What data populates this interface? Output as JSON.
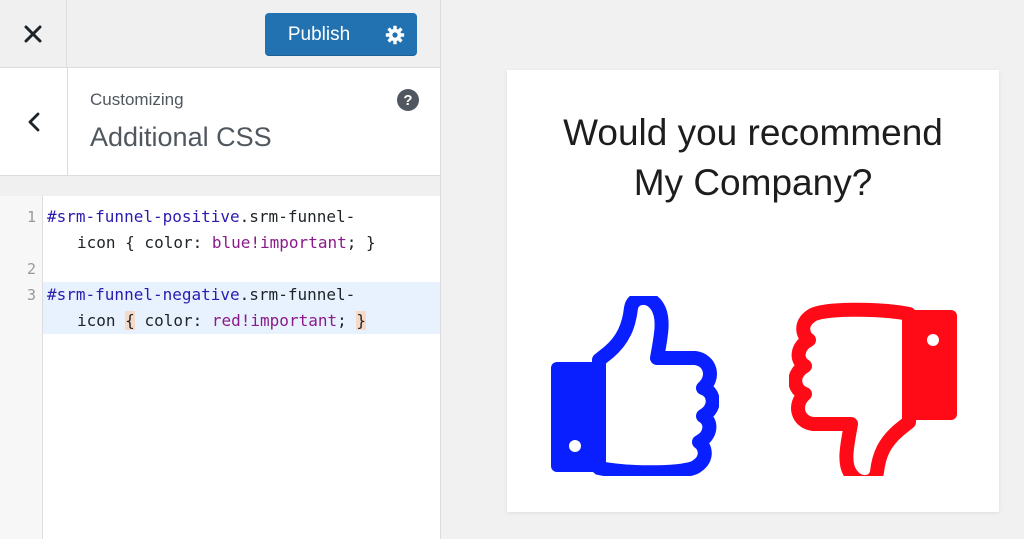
{
  "toolbar": {
    "publish_label": "Publish",
    "close_icon": "close-icon",
    "settings_icon": "gear-icon"
  },
  "section": {
    "breadcrumb": "Customizing",
    "title": "Additional CSS",
    "help_icon": "help-icon",
    "help_glyph": "?",
    "back_icon": "chevron-left-icon"
  },
  "editor": {
    "lines": [
      {
        "number": "1",
        "parts": [
          "#srm-funnel-positive",
          ".srm-funnel-"
        ],
        "cont": [
          "icon",
          " { color: ",
          "blue!important",
          "; }"
        ]
      },
      {
        "number": "2"
      },
      {
        "number": "3",
        "parts": [
          "#srm-funnel-negative",
          ".srm-funnel-"
        ],
        "cont": [
          "icon ",
          "{",
          " color: ",
          "red!important",
          "; ",
          "}"
        ]
      }
    ]
  },
  "preview": {
    "question_line1": "Would you recommend",
    "question_line2": "My Company?",
    "positive_color": "#0a1fff",
    "negative_color": "#ff0a17",
    "positive_icon": "thumbs-up-icon",
    "negative_icon": "thumbs-down-icon"
  },
  "colors": {
    "accent": "#2271b1"
  }
}
